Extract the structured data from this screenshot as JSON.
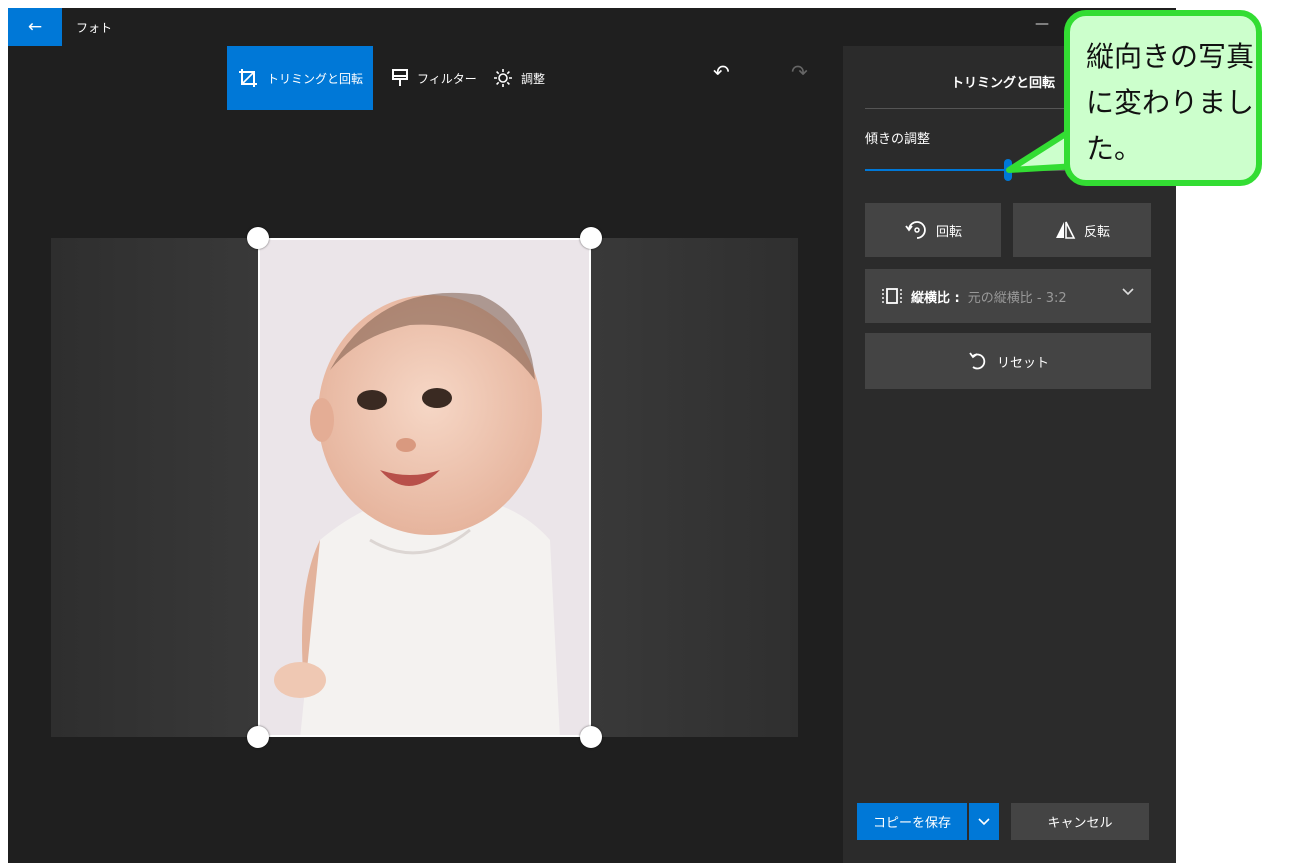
{
  "titlebar": {
    "back_icon": "←",
    "title": "フォト",
    "minimize_icon": "—"
  },
  "toolbar": {
    "crop_label": "トリミングと回転",
    "filter_label": "フィルター",
    "adjust_label": "調整",
    "undo_icon": "↶",
    "redo_icon": "↷",
    "active_color": "#0078d7"
  },
  "panel": {
    "title": "トリミングと回転",
    "tilt_label": "傾きの調整",
    "tilt_value": 0.5,
    "rotate_label": "回転",
    "flip_label": "反転",
    "aspect_label": "縦横比 :",
    "aspect_value": "元の縦横比 - 3:2",
    "reset_label": "リセット",
    "save_copy_label": "コピーを保存",
    "cancel_label": "キャンセル"
  },
  "callout": {
    "lines": [
      "縦向きの写真",
      "に変わりまし",
      "た。"
    ],
    "fill": "#ccffcc",
    "border": "#33dd33"
  },
  "icons": {
    "crop": "crop-rotate-icon",
    "filter": "filter-icon",
    "adjust": "brightness-icon",
    "rotate": "rotate-icon",
    "flip": "flip-icon",
    "aspect": "aspect-ratio-icon",
    "reset": "reset-icon",
    "chevron": "chevron-down-icon"
  }
}
